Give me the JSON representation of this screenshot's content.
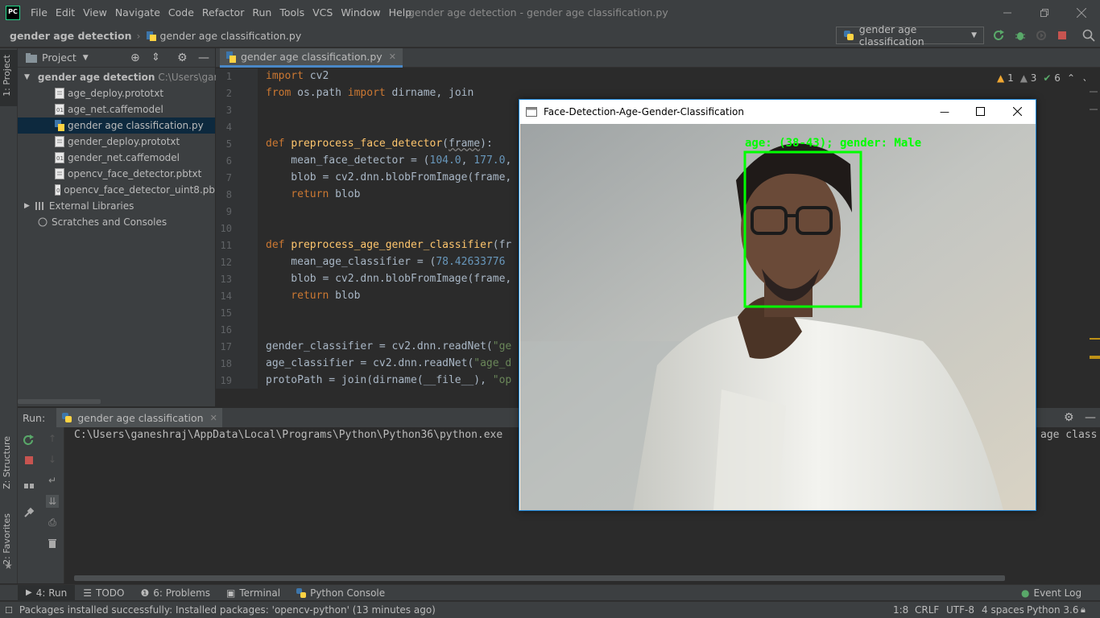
{
  "menubar": {
    "items": [
      "File",
      "Edit",
      "View",
      "Navigate",
      "Code",
      "Refactor",
      "Run",
      "Tools",
      "VCS",
      "Window",
      "Help"
    ],
    "window_title": "gender age detection - gender age classification.py"
  },
  "navbar": {
    "project": "gender age detection",
    "file": "gender age classification.py",
    "run_config": "gender age classification"
  },
  "sidebar": {
    "project_tab": "1: Project",
    "structure_tab": "Z: Structure",
    "favorites_tab": "2: Favorites"
  },
  "project": {
    "title": "Project",
    "root": "gender age detection",
    "root_path": "C:\\Users\\ganes",
    "files": [
      "age_deploy.prototxt",
      "age_net.caffemodel",
      "gender age classification.py",
      "gender_deploy.prototxt",
      "gender_net.caffemodel",
      "opencv_face_detector.pbtxt",
      "opencv_face_detector_uint8.pb"
    ],
    "external": "External Libraries",
    "scratches": "Scratches and Consoles"
  },
  "editor": {
    "tab": "gender age classification.py",
    "line_numbers": [
      "1",
      "2",
      "3",
      "4",
      "5",
      "6",
      "7",
      "8",
      "9",
      "10",
      "11",
      "12",
      "13",
      "14",
      "15",
      "16",
      "17",
      "18",
      "19"
    ],
    "inspections": {
      "warnings": "1",
      "weak": "3",
      "ok": "6"
    }
  },
  "code": {
    "l1_kw": "import",
    "l1_rest": " cv2",
    "l2_kw1": "from",
    "l2_mid": " os.path ",
    "l2_kw2": "import",
    "l2_rest": " dirname, join",
    "l5_kw": "def",
    "l5_fn": "preprocess_face_detector",
    "l5_open": "(",
    "l5_par": "frame",
    "l5_close": "):",
    "l6_a": "    mean_face_detector = (",
    "l6_n1": "104.0",
    "l6_c": ", ",
    "l6_n2": "177.0",
    "l6_d": ",",
    "l7": "    blob = cv2.dnn.blobFromImage(frame,",
    "l8_kw": "    return",
    "l8_rest": " blob",
    "l11_kw": "def",
    "l11_fn": "preprocess_age_gender_classifier",
    "l11_rest": "(fr",
    "l12_a": "    mean_age_classifier = (",
    "l12_n": "78.42633776",
    "l13": "    blob = cv2.dnn.blobFromImage(frame,",
    "l14_kw": "    return",
    "l14_rest": " blob",
    "l17_a": "gender_classifier = cv2.dnn.readNet(",
    "l17_s": "\"ge",
    "l18_a": "age_classifier = cv2.dnn.readNet(",
    "l18_s": "\"age_d",
    "l19_a": "protoPath = join(dirname(__file__), ",
    "l19_s": "\"op"
  },
  "run": {
    "label": "Run:",
    "tab": "gender age classification",
    "console_line": "C:\\Users\\ganeshraj\\AppData\\Local\\Programs\\Python\\Python36\\python.exe",
    "console_tail": "age class"
  },
  "bottom_tabs": {
    "run": "4: Run",
    "todo": "TODO",
    "problems": "6: Problems",
    "terminal": "Terminal",
    "python_console": "Python Console",
    "event_log": "Event Log"
  },
  "status": {
    "message": "Packages installed successfully: Installed packages: 'opencv-python' (13 minutes ago)",
    "position": "1:8",
    "line_sep": "CRLF",
    "encoding": "UTF-8",
    "indent": "4 spaces",
    "interpreter": "Python 3.6"
  },
  "cv_window": {
    "title": "Face-Detection-Age-Gender-Classification",
    "overlay_label": "age: (38-43); gender: Male"
  },
  "colors": {
    "accent": "#4a88c7",
    "detection_box": "#00ff00",
    "ide_bg": "#2b2b2b",
    "panel_bg": "#3c3f41"
  }
}
